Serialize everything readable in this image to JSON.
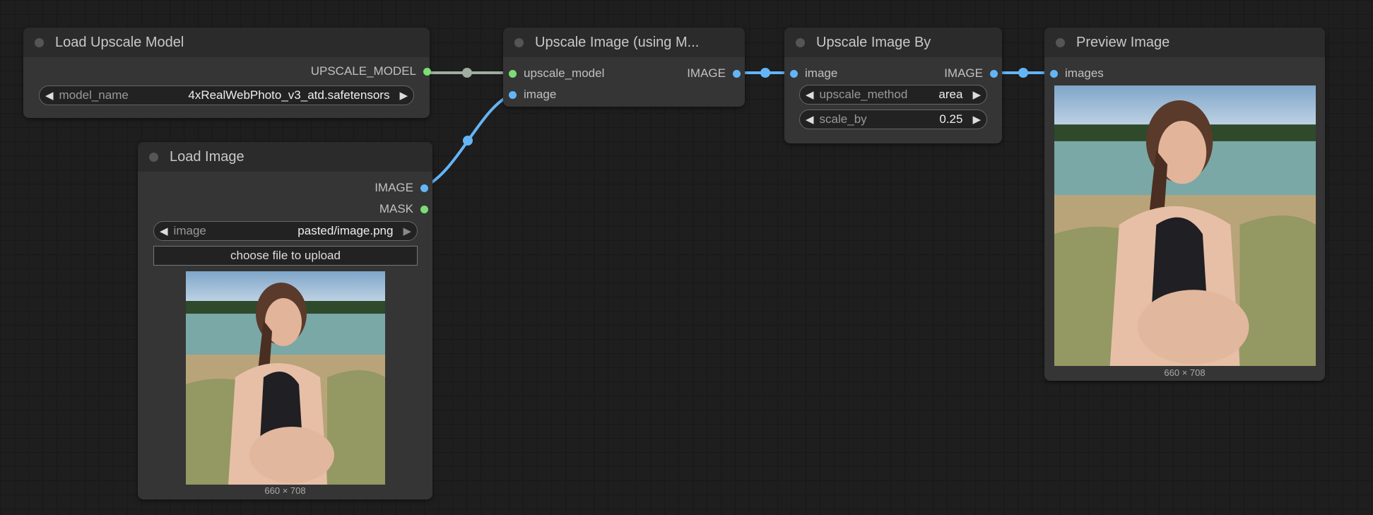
{
  "nodes": {
    "load_upscale_model": {
      "title": "Load Upscale Model",
      "output": "UPSCALE_MODEL",
      "widget_label": "model_name",
      "widget_value": "4xRealWebPhoto_v3_atd.safetensors"
    },
    "load_image": {
      "title": "Load Image",
      "output_image": "IMAGE",
      "output_mask": "MASK",
      "widget_label": "image",
      "widget_value": "pasted/image.png",
      "upload_label": "choose file to upload",
      "caption": "660 × 708"
    },
    "upscale_with_model": {
      "title": "Upscale Image (using M...",
      "input_model": "upscale_model",
      "input_image": "image",
      "output": "IMAGE"
    },
    "upscale_by": {
      "title": "Upscale Image By",
      "input": "image",
      "output": "IMAGE",
      "method_label": "upscale_method",
      "method_value": "area",
      "scale_label": "scale_by",
      "scale_value": "0.25"
    },
    "preview": {
      "title": "Preview Image",
      "input": "images",
      "caption": "660 × 708"
    }
  },
  "colors": {
    "image_link": "#64b5f6",
    "model_link": "#9fae9f",
    "model_socket": "#7ddc74",
    "mask_socket": "#7ddc74"
  },
  "icons": [
    "arrow-left-icon",
    "arrow-right-icon",
    "collapse-dot-icon"
  ]
}
